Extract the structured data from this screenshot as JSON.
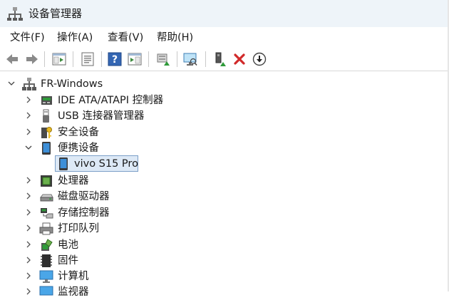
{
  "window": {
    "title": "设备管理器"
  },
  "menu": [
    "文件(F)",
    "操作(A)",
    "查看(V)",
    "帮助(H)"
  ],
  "toolbar": [
    {
      "icon": "back-arrow-icon"
    },
    {
      "icon": "forward-arrow-icon"
    },
    {
      "icon": "show-hide-console-tree-icon"
    },
    {
      "icon": "properties-icon"
    },
    {
      "icon": "help-icon"
    },
    {
      "icon": "action-pane-icon"
    },
    {
      "icon": "update-driver-icon"
    },
    {
      "icon": "scan-hardware-icon"
    },
    {
      "icon": "enable-device-icon"
    },
    {
      "icon": "uninstall-device-icon"
    },
    {
      "icon": "download-driver-icon"
    }
  ],
  "tree": {
    "root": "FR-Windows",
    "items": [
      {
        "label": "IDE ATA/ATAPI 控制器",
        "icon": "ide-controller-icon",
        "expanded": false
      },
      {
        "label": "USB 连接器管理器",
        "icon": "usb-icon",
        "expanded": false
      },
      {
        "label": "安全设备",
        "icon": "security-device-icon",
        "expanded": false
      },
      {
        "label": "便携设备",
        "icon": "portable-device-icon",
        "expanded": true
      },
      {
        "label": "vivo S15 Pro",
        "icon": "phone-icon",
        "child": true,
        "selected": true
      },
      {
        "label": "处理器",
        "icon": "processor-icon",
        "expanded": false
      },
      {
        "label": "磁盘驱动器",
        "icon": "disk-drive-icon",
        "expanded": false
      },
      {
        "label": "存储控制器",
        "icon": "storage-controller-icon",
        "expanded": false
      },
      {
        "label": "打印队列",
        "icon": "printer-icon",
        "expanded": false
      },
      {
        "label": "电池",
        "icon": "battery-icon",
        "expanded": false
      },
      {
        "label": "固件",
        "icon": "firmware-icon",
        "expanded": false
      },
      {
        "label": "计算机",
        "icon": "computer-icon",
        "expanded": false
      },
      {
        "label": "监视器",
        "icon": "monitor-icon",
        "expanded": false
      }
    ]
  },
  "colors": {
    "titlebar": "#eef4f9",
    "selection": "#dde9f6",
    "selection_border": "#7a9ec7",
    "accent": "#2f6db5"
  }
}
